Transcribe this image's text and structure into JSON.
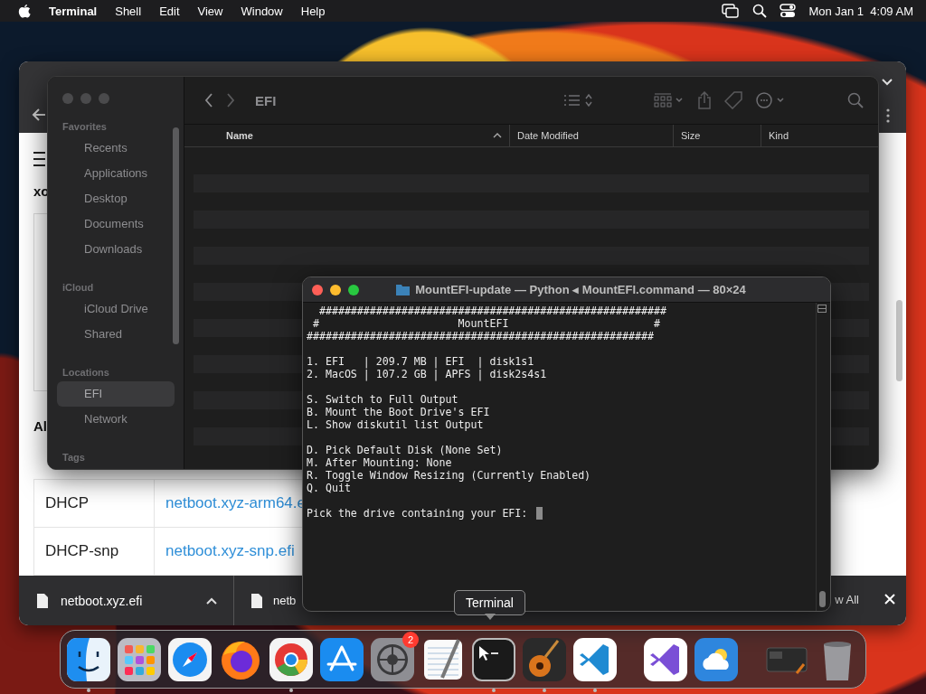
{
  "menu_bar": {
    "app_name": "Terminal",
    "menus": [
      "Shell",
      "Edit",
      "View",
      "Window",
      "Help"
    ],
    "clock": "Mon Jan 1  4:09 AM"
  },
  "browser": {
    "heading": "xo",
    "section_heading": "Al",
    "table": {
      "rows": [
        [
          "DHCP",
          "netboot.xyz-arm64.e"
        ],
        [
          "DHCP-snp",
          "netboot.xyz-snp.efi"
        ]
      ]
    },
    "downloads": [
      "netboot.xyz.efi",
      "netb"
    ],
    "show_all": "w All"
  },
  "finder": {
    "title": "EFI",
    "sidebar": [
      {
        "heading": "Favorites",
        "items": [
          {
            "label": "Recents",
            "selected": false
          },
          {
            "label": "Applications",
            "selected": false
          },
          {
            "label": "Desktop",
            "selected": false
          },
          {
            "label": "Documents",
            "selected": false
          },
          {
            "label": "Downloads",
            "selected": false
          }
        ]
      },
      {
        "heading": "iCloud",
        "items": [
          {
            "label": "iCloud Drive",
            "selected": false
          },
          {
            "label": "Shared",
            "selected": false
          }
        ]
      },
      {
        "heading": "Locations",
        "items": [
          {
            "label": "EFI",
            "selected": true
          },
          {
            "label": "Network",
            "selected": false
          }
        ]
      },
      {
        "heading": "Tags"
      }
    ],
    "columns": [
      {
        "label": "Name",
        "sorted": true
      },
      {
        "label": "Date Modified",
        "sorted": false
      },
      {
        "label": "Size",
        "sorted": false
      },
      {
        "label": "Kind",
        "sorted": false
      }
    ]
  },
  "terminal": {
    "title": "MountEFI-update — Python ◂ MountEFI.command — 80×24",
    "blocks": [
      [
        "  #######################################################",
        " #                      MountEFI                       #",
        "#######################################################"
      ],
      [
        "1. EFI   | 209.7 MB | EFI  | disk1s1",
        "2. MacOS | 107.2 GB | APFS | disk2s4s1"
      ],
      [
        "S. Switch to Full Output",
        "B. Mount the Boot Drive's EFI",
        "L. Show diskutil list Output"
      ],
      [
        "D. Pick Default Disk (None Set)",
        "M. After Mounting: None",
        "R. Toggle Window Resizing (Currently Enabled)",
        "Q. Quit"
      ]
    ],
    "prompt": "Pick the drive containing your EFI:"
  },
  "tooltip": "Terminal",
  "dock": {
    "groups": [
      [
        {
          "kind": "finder",
          "running": true
        },
        {
          "kind": "launchpad",
          "running": false
        },
        {
          "kind": "safari",
          "running": false
        },
        {
          "kind": "firefox",
          "running": false
        },
        {
          "kind": "chrome",
          "running": true
        },
        {
          "kind": "appstore",
          "running": false
        },
        {
          "kind": "settings",
          "running": false,
          "badge": "2"
        },
        {
          "kind": "textedit",
          "running": false
        },
        {
          "kind": "terminal",
          "running": true
        },
        {
          "kind": "garageband",
          "running": true
        },
        {
          "kind": "vscode",
          "running": true
        }
      ],
      [
        {
          "kind": "studio",
          "running": false
        },
        {
          "kind": "weather",
          "running": false
        }
      ],
      [
        {
          "kind": "minimized",
          "running": false
        },
        {
          "kind": "trash",
          "running": false
        }
      ]
    ]
  }
}
